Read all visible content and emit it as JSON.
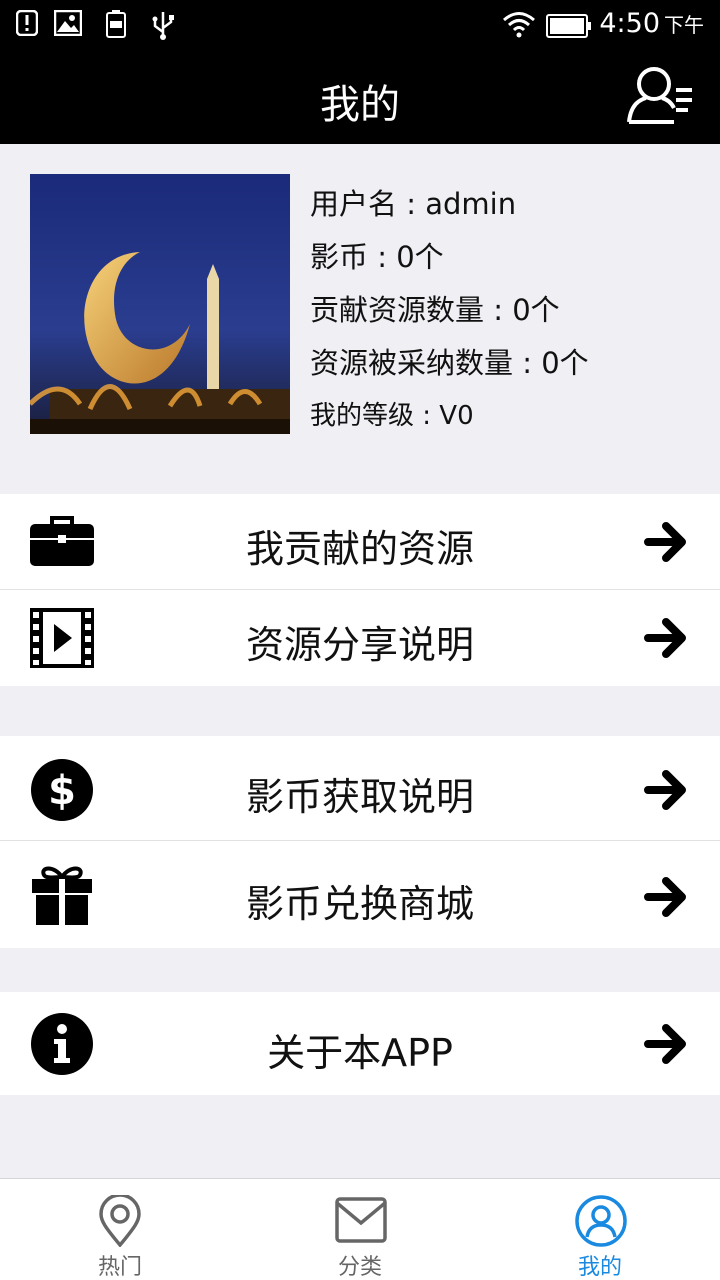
{
  "status_bar": {
    "time": "4:50",
    "ampm": "下午",
    "icons": [
      "alert-icon",
      "image-icon",
      "battery-100-icon",
      "usb-icon",
      "wifi-icon",
      "battery-icon"
    ]
  },
  "header": {
    "title": "我的"
  },
  "profile": {
    "username": "用户名 : admin",
    "coins": "影币 : 0个",
    "contributed": "贡献资源数量 : 0个",
    "adopted": "资源被采纳数量 : 0个",
    "level": "我的等级 : V0"
  },
  "menu": {
    "group1": [
      {
        "label": "我贡献的资源",
        "icon": "briefcase-icon"
      },
      {
        "label": "资源分享说明",
        "icon": "video-icon"
      }
    ],
    "group2": [
      {
        "label": "影币获取说明",
        "icon": "dollar-icon"
      },
      {
        "label": "影币兑换商城",
        "icon": "gift-icon"
      }
    ],
    "group3": [
      {
        "label": "关于本APP",
        "icon": "info-icon"
      }
    ]
  },
  "tabs": [
    {
      "label": "热门",
      "icon": "location-pin-icon",
      "active": false
    },
    {
      "label": "分类",
      "icon": "envelope-icon",
      "active": false
    },
    {
      "label": "我的",
      "icon": "user-circle-icon",
      "active": true
    }
  ],
  "colors": {
    "accent": "#1a8ae0",
    "header_bg": "#000000",
    "page_bg": "#efeff4"
  }
}
